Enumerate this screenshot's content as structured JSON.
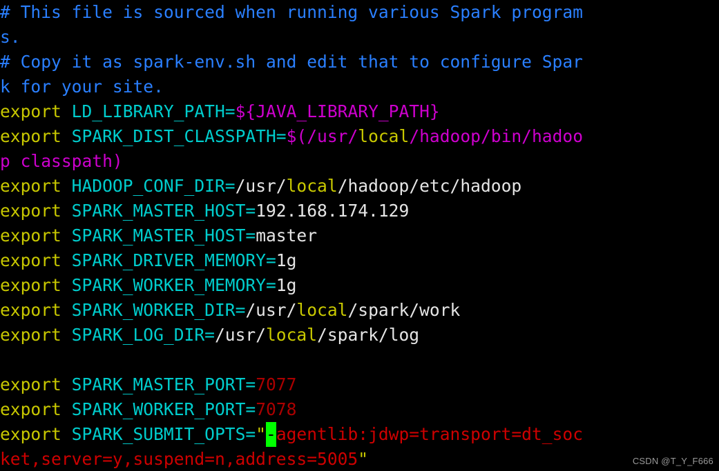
{
  "terminal": {
    "title": "spark-env.sh",
    "columns": 57,
    "rows": 19,
    "background_color": "#000000",
    "colors": {
      "comment": "#2a7fff",
      "keyword": "#c8c800",
      "variable": "#00cdcd",
      "plain_text": "#e5e5e5",
      "substitution": "#cd00cd",
      "number": "#aa0000",
      "string": "#cd0000",
      "quote": "#c8c800",
      "cursor_background": "#00ff00",
      "cursor_foreground": "#000000"
    },
    "lines": [
      {
        "id": "line-comment-1a",
        "segments": [
          {
            "text": "# This file is sourced when running various Spark program",
            "kind": "comment"
          }
        ]
      },
      {
        "id": "line-comment-1b",
        "segments": [
          {
            "text": "s.",
            "kind": "comment"
          }
        ]
      },
      {
        "id": "line-comment-2a",
        "segments": [
          {
            "text": "# Copy it as spark-env.sh and edit that to configure Spar",
            "kind": "comment"
          }
        ]
      },
      {
        "id": "line-comment-2b",
        "segments": [
          {
            "text": "k for your site.",
            "kind": "comment"
          }
        ]
      },
      {
        "id": "line-ld-library-path",
        "segments": [
          {
            "text": "export ",
            "kind": "keyword"
          },
          {
            "text": "LD_LIBRARY_PATH=",
            "kind": "variable"
          },
          {
            "text": "${JAVA_LIBRARY_PATH}",
            "kind": "substitution"
          }
        ]
      },
      {
        "id": "line-spark-dist-classpath-a",
        "segments": [
          {
            "text": "export ",
            "kind": "keyword"
          },
          {
            "text": "SPARK_DIST_CLASSPATH=",
            "kind": "variable"
          },
          {
            "text": "$(/usr/",
            "kind": "substitution"
          },
          {
            "text": "local",
            "kind": "builtin"
          },
          {
            "text": "/hadoop/bin/hadoo",
            "kind": "substitution"
          }
        ]
      },
      {
        "id": "line-spark-dist-classpath-b",
        "segments": [
          {
            "text": "p classpath)",
            "kind": "substitution"
          }
        ]
      },
      {
        "id": "line-hadoop-conf-dir",
        "segments": [
          {
            "text": "export ",
            "kind": "keyword"
          },
          {
            "text": "HADOOP_CONF_DIR=",
            "kind": "variable"
          },
          {
            "text": "/usr/",
            "kind": "plain"
          },
          {
            "text": "local",
            "kind": "builtin"
          },
          {
            "text": "/hadoop/etc/hadoop",
            "kind": "plain"
          }
        ]
      },
      {
        "id": "line-spark-master-host-ip",
        "segments": [
          {
            "text": "export ",
            "kind": "keyword"
          },
          {
            "text": "SPARK_MASTER_HOST=",
            "kind": "variable"
          },
          {
            "text": "192.168.174.129",
            "kind": "plain"
          }
        ]
      },
      {
        "id": "line-spark-master-host-name",
        "segments": [
          {
            "text": "export ",
            "kind": "keyword"
          },
          {
            "text": "SPARK_MASTER_HOST=",
            "kind": "variable"
          },
          {
            "text": "master",
            "kind": "plain"
          }
        ]
      },
      {
        "id": "line-spark-driver-memory",
        "segments": [
          {
            "text": "export ",
            "kind": "keyword"
          },
          {
            "text": "SPARK_DRIVER_MEMORY=",
            "kind": "variable"
          },
          {
            "text": "1g",
            "kind": "plain"
          }
        ]
      },
      {
        "id": "line-spark-worker-memory",
        "segments": [
          {
            "text": "export ",
            "kind": "keyword"
          },
          {
            "text": "SPARK_WORKER_MEMORY=",
            "kind": "variable"
          },
          {
            "text": "1g",
            "kind": "plain"
          }
        ]
      },
      {
        "id": "line-spark-worker-dir",
        "segments": [
          {
            "text": "export ",
            "kind": "keyword"
          },
          {
            "text": "SPARK_WORKER_DIR=",
            "kind": "variable"
          },
          {
            "text": "/usr/",
            "kind": "plain"
          },
          {
            "text": "local",
            "kind": "builtin"
          },
          {
            "text": "/spark/work",
            "kind": "plain"
          }
        ]
      },
      {
        "id": "line-spark-log-dir",
        "segments": [
          {
            "text": "export ",
            "kind": "keyword"
          },
          {
            "text": "SPARK_LOG_DIR=",
            "kind": "variable"
          },
          {
            "text": "/usr/",
            "kind": "plain"
          },
          {
            "text": "local",
            "kind": "builtin"
          },
          {
            "text": "/spark/log",
            "kind": "plain"
          }
        ]
      },
      {
        "id": "line-blank-1",
        "segments": [
          {
            "text": "",
            "kind": "plain"
          }
        ]
      },
      {
        "id": "line-spark-master-port",
        "segments": [
          {
            "text": "export ",
            "kind": "keyword"
          },
          {
            "text": "SPARK_MASTER_PORT=",
            "kind": "variable"
          },
          {
            "text": "7077",
            "kind": "number"
          }
        ]
      },
      {
        "id": "line-spark-worker-port",
        "segments": [
          {
            "text": "export ",
            "kind": "keyword"
          },
          {
            "text": "SPARK_WORKER_PORT=",
            "kind": "variable"
          },
          {
            "text": "7078",
            "kind": "number"
          }
        ]
      },
      {
        "id": "line-spark-submit-opts-a",
        "segments": [
          {
            "text": "export ",
            "kind": "keyword"
          },
          {
            "text": "SPARK_SUBMIT_OPTS=",
            "kind": "variable"
          },
          {
            "text": "\"",
            "kind": "quote"
          },
          {
            "text": "-",
            "kind": "cursor"
          },
          {
            "text": "agentlib:jdwp=transport=dt_soc",
            "kind": "string"
          }
        ]
      },
      {
        "id": "line-spark-submit-opts-b",
        "segments": [
          {
            "text": "ket,server=y,suspend=n,address=5005",
            "kind": "string"
          },
          {
            "text": "\"",
            "kind": "quote"
          }
        ]
      }
    ]
  },
  "watermark": {
    "text": "CSDN @T_Y_F666"
  }
}
